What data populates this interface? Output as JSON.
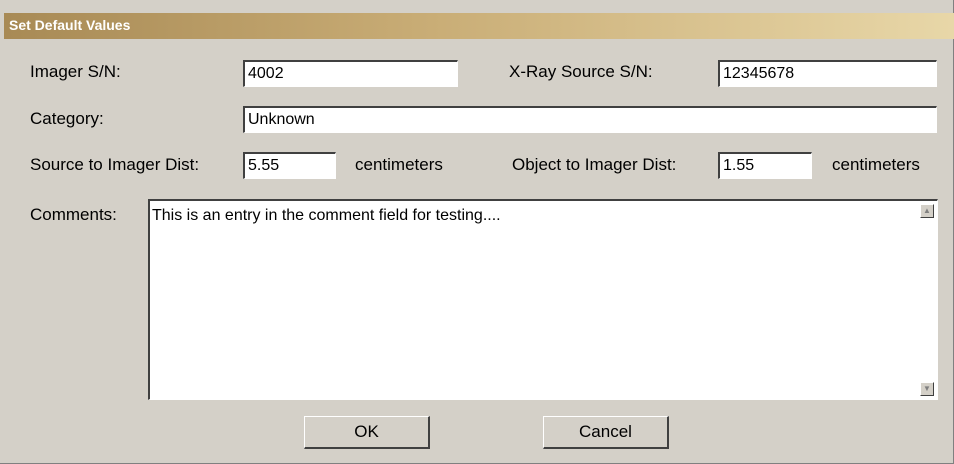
{
  "dialog": {
    "title": "Set Default Values",
    "imager_sn": {
      "label": "Imager S/N:",
      "value": "4002"
    },
    "xray_sn": {
      "label": "X-Ray Source S/N:",
      "value": "12345678"
    },
    "category": {
      "label": "Category:",
      "value": "Unknown"
    },
    "source_dist": {
      "label": "Source to Imager Dist:",
      "value": "5.55",
      "unit": "centimeters"
    },
    "object_dist": {
      "label": "Object to Imager Dist:",
      "value": "1.55",
      "unit": "centimeters"
    },
    "comments": {
      "label": "Comments:",
      "value": "This is an entry in the comment field for testing...."
    },
    "ok_label": "OK",
    "cancel_label": "Cancel"
  }
}
